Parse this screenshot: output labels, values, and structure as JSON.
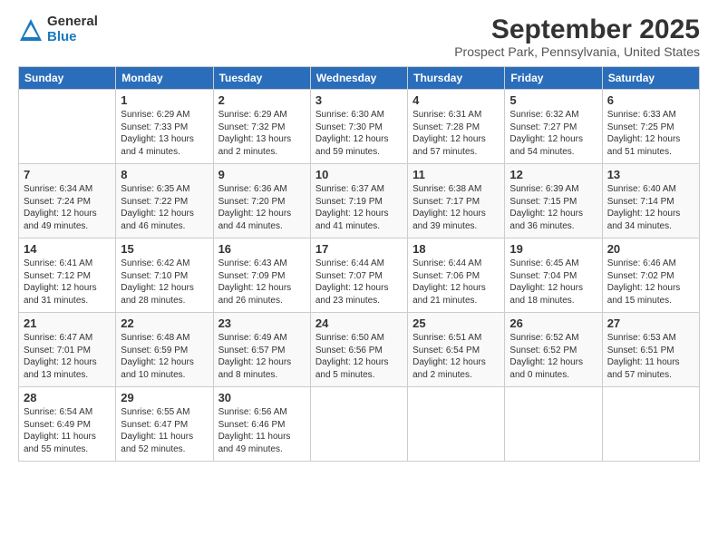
{
  "logo": {
    "general": "General",
    "blue": "Blue"
  },
  "header": {
    "title": "September 2025",
    "location": "Prospect Park, Pennsylvania, United States"
  },
  "weekdays": [
    "Sunday",
    "Monday",
    "Tuesday",
    "Wednesday",
    "Thursday",
    "Friday",
    "Saturday"
  ],
  "weeks": [
    [
      {
        "day": "",
        "info": ""
      },
      {
        "day": "1",
        "info": "Sunrise: 6:29 AM\nSunset: 7:33 PM\nDaylight: 13 hours\nand 4 minutes."
      },
      {
        "day": "2",
        "info": "Sunrise: 6:29 AM\nSunset: 7:32 PM\nDaylight: 13 hours\nand 2 minutes."
      },
      {
        "day": "3",
        "info": "Sunrise: 6:30 AM\nSunset: 7:30 PM\nDaylight: 12 hours\nand 59 minutes."
      },
      {
        "day": "4",
        "info": "Sunrise: 6:31 AM\nSunset: 7:28 PM\nDaylight: 12 hours\nand 57 minutes."
      },
      {
        "day": "5",
        "info": "Sunrise: 6:32 AM\nSunset: 7:27 PM\nDaylight: 12 hours\nand 54 minutes."
      },
      {
        "day": "6",
        "info": "Sunrise: 6:33 AM\nSunset: 7:25 PM\nDaylight: 12 hours\nand 51 minutes."
      }
    ],
    [
      {
        "day": "7",
        "info": "Sunrise: 6:34 AM\nSunset: 7:24 PM\nDaylight: 12 hours\nand 49 minutes."
      },
      {
        "day": "8",
        "info": "Sunrise: 6:35 AM\nSunset: 7:22 PM\nDaylight: 12 hours\nand 46 minutes."
      },
      {
        "day": "9",
        "info": "Sunrise: 6:36 AM\nSunset: 7:20 PM\nDaylight: 12 hours\nand 44 minutes."
      },
      {
        "day": "10",
        "info": "Sunrise: 6:37 AM\nSunset: 7:19 PM\nDaylight: 12 hours\nand 41 minutes."
      },
      {
        "day": "11",
        "info": "Sunrise: 6:38 AM\nSunset: 7:17 PM\nDaylight: 12 hours\nand 39 minutes."
      },
      {
        "day": "12",
        "info": "Sunrise: 6:39 AM\nSunset: 7:15 PM\nDaylight: 12 hours\nand 36 minutes."
      },
      {
        "day": "13",
        "info": "Sunrise: 6:40 AM\nSunset: 7:14 PM\nDaylight: 12 hours\nand 34 minutes."
      }
    ],
    [
      {
        "day": "14",
        "info": "Sunrise: 6:41 AM\nSunset: 7:12 PM\nDaylight: 12 hours\nand 31 minutes."
      },
      {
        "day": "15",
        "info": "Sunrise: 6:42 AM\nSunset: 7:10 PM\nDaylight: 12 hours\nand 28 minutes."
      },
      {
        "day": "16",
        "info": "Sunrise: 6:43 AM\nSunset: 7:09 PM\nDaylight: 12 hours\nand 26 minutes."
      },
      {
        "day": "17",
        "info": "Sunrise: 6:44 AM\nSunset: 7:07 PM\nDaylight: 12 hours\nand 23 minutes."
      },
      {
        "day": "18",
        "info": "Sunrise: 6:44 AM\nSunset: 7:06 PM\nDaylight: 12 hours\nand 21 minutes."
      },
      {
        "day": "19",
        "info": "Sunrise: 6:45 AM\nSunset: 7:04 PM\nDaylight: 12 hours\nand 18 minutes."
      },
      {
        "day": "20",
        "info": "Sunrise: 6:46 AM\nSunset: 7:02 PM\nDaylight: 12 hours\nand 15 minutes."
      }
    ],
    [
      {
        "day": "21",
        "info": "Sunrise: 6:47 AM\nSunset: 7:01 PM\nDaylight: 12 hours\nand 13 minutes."
      },
      {
        "day": "22",
        "info": "Sunrise: 6:48 AM\nSunset: 6:59 PM\nDaylight: 12 hours\nand 10 minutes."
      },
      {
        "day": "23",
        "info": "Sunrise: 6:49 AM\nSunset: 6:57 PM\nDaylight: 12 hours\nand 8 minutes."
      },
      {
        "day": "24",
        "info": "Sunrise: 6:50 AM\nSunset: 6:56 PM\nDaylight: 12 hours\nand 5 minutes."
      },
      {
        "day": "25",
        "info": "Sunrise: 6:51 AM\nSunset: 6:54 PM\nDaylight: 12 hours\nand 2 minutes."
      },
      {
        "day": "26",
        "info": "Sunrise: 6:52 AM\nSunset: 6:52 PM\nDaylight: 12 hours\nand 0 minutes."
      },
      {
        "day": "27",
        "info": "Sunrise: 6:53 AM\nSunset: 6:51 PM\nDaylight: 11 hours\nand 57 minutes."
      }
    ],
    [
      {
        "day": "28",
        "info": "Sunrise: 6:54 AM\nSunset: 6:49 PM\nDaylight: 11 hours\nand 55 minutes."
      },
      {
        "day": "29",
        "info": "Sunrise: 6:55 AM\nSunset: 6:47 PM\nDaylight: 11 hours\nand 52 minutes."
      },
      {
        "day": "30",
        "info": "Sunrise: 6:56 AM\nSunset: 6:46 PM\nDaylight: 11 hours\nand 49 minutes."
      },
      {
        "day": "",
        "info": ""
      },
      {
        "day": "",
        "info": ""
      },
      {
        "day": "",
        "info": ""
      },
      {
        "day": "",
        "info": ""
      }
    ]
  ]
}
